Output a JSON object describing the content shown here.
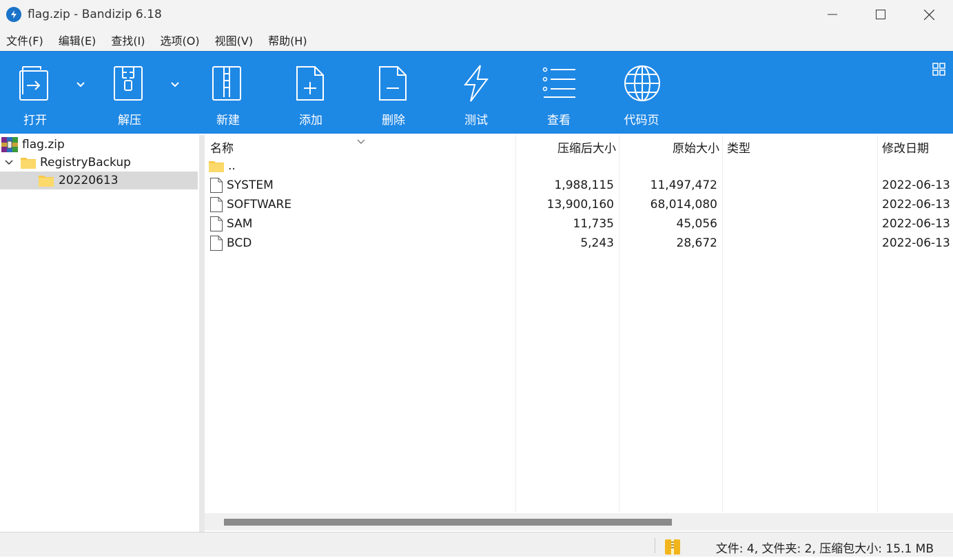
{
  "window": {
    "title": "flag.zip - Bandizip 6.18"
  },
  "menu": [
    "文件(F)",
    "编辑(E)",
    "查找(I)",
    "选项(O)",
    "视图(V)",
    "帮助(H)"
  ],
  "toolbar": {
    "open": "打开",
    "extract": "解压",
    "new": "新建",
    "add": "添加",
    "delete": "删除",
    "test": "测试",
    "view": "查看",
    "codepage": "代码页"
  },
  "tree": {
    "root": "flag.zip",
    "folder": "RegistryBackup",
    "subfolder": "20220613"
  },
  "list": {
    "headers": {
      "name": "名称",
      "packed": "压缩后大小",
      "original": "原始大小",
      "type": "类型",
      "modified": "修改日期"
    },
    "parent": "..",
    "rows": [
      {
        "name": "SYSTEM",
        "packed": "1,988,115",
        "original": "11,497,472",
        "type": "",
        "modified": "2022-06-13"
      },
      {
        "name": "SOFTWARE",
        "packed": "13,900,160",
        "original": "68,014,080",
        "type": "",
        "modified": "2022-06-13"
      },
      {
        "name": "SAM",
        "packed": "11,735",
        "original": "45,056",
        "type": "",
        "modified": "2022-06-13"
      },
      {
        "name": "BCD",
        "packed": "5,243",
        "original": "28,672",
        "type": "",
        "modified": "2022-06-13"
      }
    ]
  },
  "status": {
    "summary": "文件: 4, 文件夹: 2, 压缩包大小: 15.1 MB"
  },
  "colors": {
    "toolbar": "#1e88e5",
    "folder": "#f7c948",
    "selection": "#d9d9d9"
  }
}
